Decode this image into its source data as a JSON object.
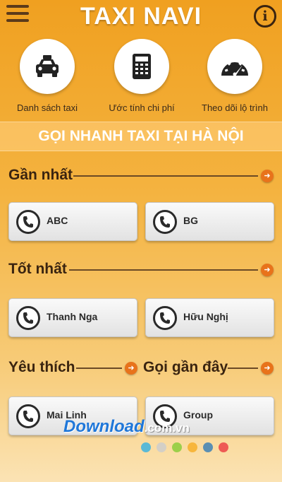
{
  "app": {
    "title": "TAXI NAVI"
  },
  "colors": {
    "accent_orange": "#f0a020",
    "arrow_orange": "#e8731b",
    "text_brown": "#3a2410"
  },
  "features": [
    {
      "icon": "taxi-icon",
      "label": "Danh sách taxi"
    },
    {
      "icon": "calculator-icon",
      "label": "Ước tính chi phí"
    },
    {
      "icon": "speedometer-icon",
      "label": "Theo dõi lộ trình"
    }
  ],
  "banner": {
    "text": "GỌI NHANH TAXI TẠI HÀ NỘI"
  },
  "sections": {
    "nearest": {
      "title": "Gần nhất",
      "items": [
        "ABC",
        "BG"
      ]
    },
    "best": {
      "title": "Tốt nhất",
      "items": [
        "Thanh Nga",
        "Hữu Nghị"
      ]
    },
    "favorites": {
      "title": "Yêu thích",
      "items": [
        "Mai Linh"
      ]
    },
    "recent": {
      "title": "Gọi gần đây",
      "items": [
        "Group"
      ]
    }
  },
  "watermark": {
    "main": "Download",
    "suffix": ".com.vn"
  },
  "page_dots": {
    "colors": [
      "#5bb9d6",
      "#d4cfc6",
      "#9ccf4a",
      "#f7b63c",
      "#5a8fb3",
      "#ee5a54"
    ]
  }
}
